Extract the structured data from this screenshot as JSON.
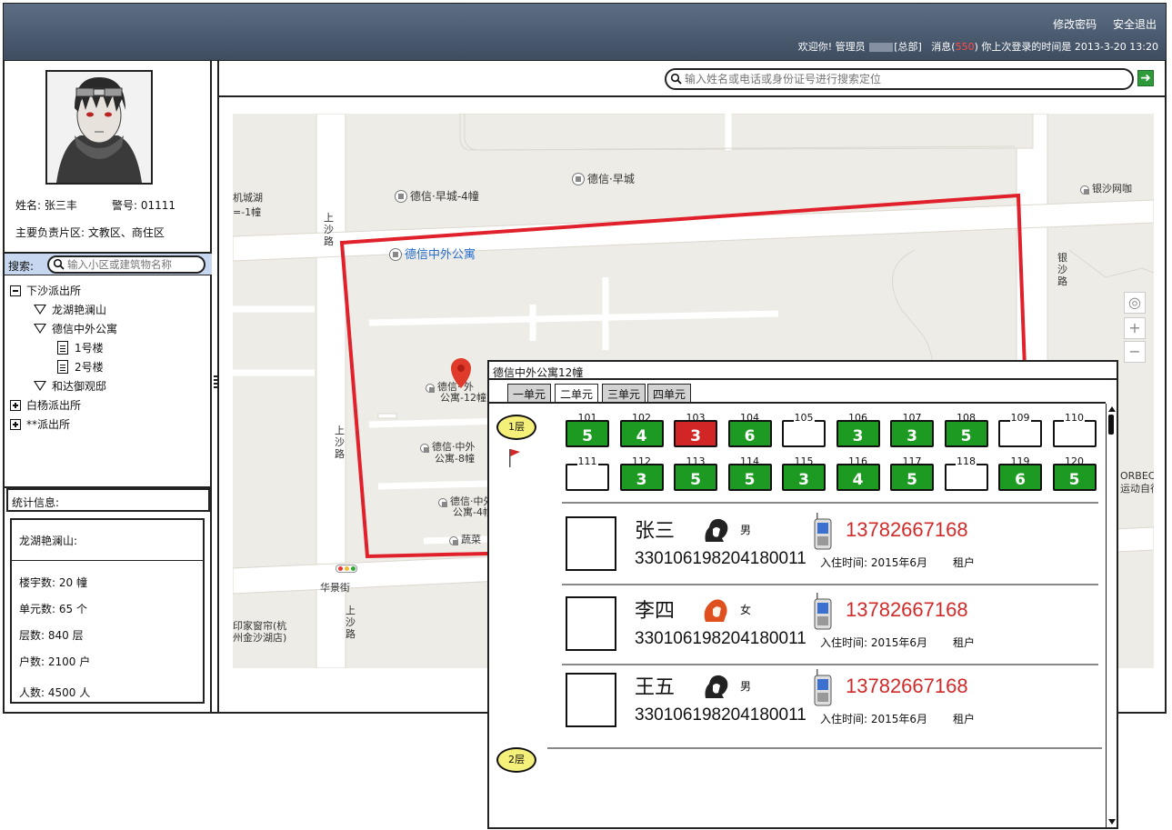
{
  "header": {
    "change_password": "修改密码",
    "logout": "安全退出",
    "welcome": "欢迎你! 管理员",
    "dept": "[总部]",
    "msg_label": "消息(",
    "msg_count": "550",
    "msg_close": ")",
    "last_login_label": "你上次登录的时间是",
    "last_login_time": "2013-3-20 13:20"
  },
  "profile": {
    "name_label": "姓名: 张三丰",
    "badge_label": "警号: 01111",
    "area_label": "主要负责片区: 文教区、商住区"
  },
  "sidebar_search": {
    "label": "搜索:",
    "placeholder": "输入小区或建筑物名称"
  },
  "tree": {
    "n0": "下沙派出所",
    "n1": "龙湖艳澜山",
    "n2": "德信中外公寓",
    "n3": "1号楼",
    "n4": "2号楼",
    "n5": "和达御观邸",
    "n6": "白杨派出所",
    "n7": "**派出所"
  },
  "stats": {
    "header": "统计信息:",
    "community": "龙湖艳澜山:",
    "buildings": "楼宇数: 20 幢",
    "units": "单元数: 65 个",
    "floors": "层数: 840 层",
    "households": "户数: 2100 户",
    "people": "人数: 4500 人"
  },
  "top_search": {
    "placeholder": "输入姓名或电话或身份证号进行搜索定位",
    "go_icon": "arrow-right-icon"
  },
  "map": {
    "l1": "机城湖",
    "l1b": "=-1幢",
    "l2": "德信·早城-4幢",
    "l3": "德信·早城",
    "l4": "银沙网咖",
    "l5": "上沙路",
    "l6": "德信中外公寓",
    "l7": "银沙路",
    "l8": "德信·",
    "l8b": "公寓-12幢",
    "l8c": "外",
    "l9": "上沙路",
    "l10": "德信·中外",
    "l10b": "公寓-8幢",
    "l11": "德信·中外",
    "l11b": "公寓-4幢",
    "l12": "蔬菜",
    "l13": "华景街",
    "l14": "上沙路",
    "l15": "印家窗帘(杭",
    "l15b": "州金沙湖店)",
    "l16": "ORBEC U",
    "l16b": "运动自行"
  },
  "popup": {
    "title": "德信中外公寓12幢",
    "tabs": [
      "一单元",
      "二单元",
      "三单元",
      "四单元"
    ],
    "floor1": "1层",
    "floor2": "2层",
    "rooms_row1": [
      {
        "no": "101",
        "count": "5",
        "status": "green"
      },
      {
        "no": "102",
        "count": "4",
        "status": "green"
      },
      {
        "no": "103",
        "count": "3",
        "status": "red"
      },
      {
        "no": "104",
        "count": "6",
        "status": "green"
      },
      {
        "no": "105",
        "count": "",
        "status": "empty"
      },
      {
        "no": "106",
        "count": "3",
        "status": "green"
      },
      {
        "no": "107",
        "count": "3",
        "status": "green"
      },
      {
        "no": "108",
        "count": "5",
        "status": "green"
      },
      {
        "no": "109",
        "count": "",
        "status": "empty"
      },
      {
        "no": "110",
        "count": "",
        "status": "empty"
      }
    ],
    "rooms_row2": [
      {
        "no": "111",
        "count": "",
        "status": "empty"
      },
      {
        "no": "112",
        "count": "3",
        "status": "green"
      },
      {
        "no": "113",
        "count": "5",
        "status": "green"
      },
      {
        "no": "114",
        "count": "5",
        "status": "green"
      },
      {
        "no": "115",
        "count": "3",
        "status": "green"
      },
      {
        "no": "116",
        "count": "4",
        "status": "green"
      },
      {
        "no": "117",
        "count": "5",
        "status": "green"
      },
      {
        "no": "118",
        "count": "",
        "status": "empty"
      },
      {
        "no": "119",
        "count": "6",
        "status": "green"
      },
      {
        "no": "120",
        "count": "5",
        "status": "green"
      }
    ],
    "residents": [
      {
        "name": "张三",
        "gender": "男",
        "phone": "13782667168",
        "id": "330106198204180011",
        "since": "入住时间: 2015年6月",
        "type": "租户"
      },
      {
        "name": "李四",
        "gender": "女",
        "phone": "13782667168",
        "id": "330106198204180011",
        "since": "入住时间: 2015年6月",
        "type": "租户"
      },
      {
        "name": "王五",
        "gender": "男",
        "phone": "13782667168",
        "id": "330106198204180011",
        "since": "入住时间: 2015年6月",
        "type": "租户"
      }
    ]
  },
  "colors": {
    "header_bg": "#4a5a6e",
    "occupied": "#1d9a22",
    "alert": "#d22626",
    "phone_text": "#d12a2a",
    "boundary": "#e0202a"
  }
}
